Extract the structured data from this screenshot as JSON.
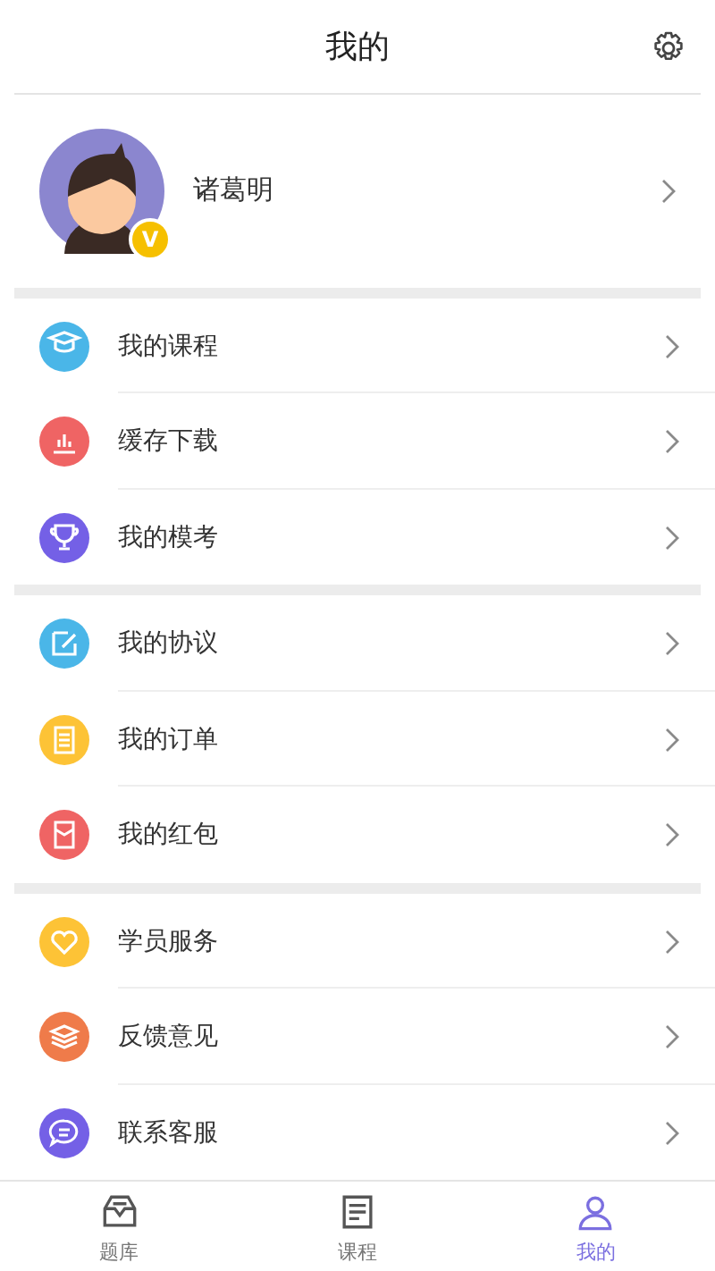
{
  "header": {
    "title": "我的"
  },
  "profile": {
    "name": "诸葛明",
    "vip_badge": "V"
  },
  "sections": [
    {
      "items": [
        {
          "kind": "cap",
          "label": "我的课程",
          "color": "#4ab6e8"
        },
        {
          "kind": "chart",
          "label": "缓存下载",
          "color": "#ef6464"
        },
        {
          "kind": "trophy",
          "label": "我的模考",
          "color": "#7460e6"
        }
      ]
    },
    {
      "items": [
        {
          "kind": "edit",
          "label": "我的协议",
          "color": "#4ab6e8"
        },
        {
          "kind": "list",
          "label": "我的订单",
          "color": "#fdc336"
        },
        {
          "kind": "packet",
          "label": "我的红包",
          "color": "#ef6464"
        }
      ]
    },
    {
      "items": [
        {
          "kind": "heart",
          "label": "学员服务",
          "color": "#fdc336"
        },
        {
          "kind": "stack",
          "label": "反馈意见",
          "color": "#ef7b4a"
        },
        {
          "kind": "chat",
          "label": "联系客服",
          "color": "#7460e6"
        }
      ]
    }
  ],
  "tabs": [
    {
      "kind": "inbox",
      "label": "题库",
      "selected": false
    },
    {
      "kind": "book",
      "label": "课程",
      "selected": false
    },
    {
      "kind": "person",
      "label": "我的",
      "selected": true
    }
  ]
}
